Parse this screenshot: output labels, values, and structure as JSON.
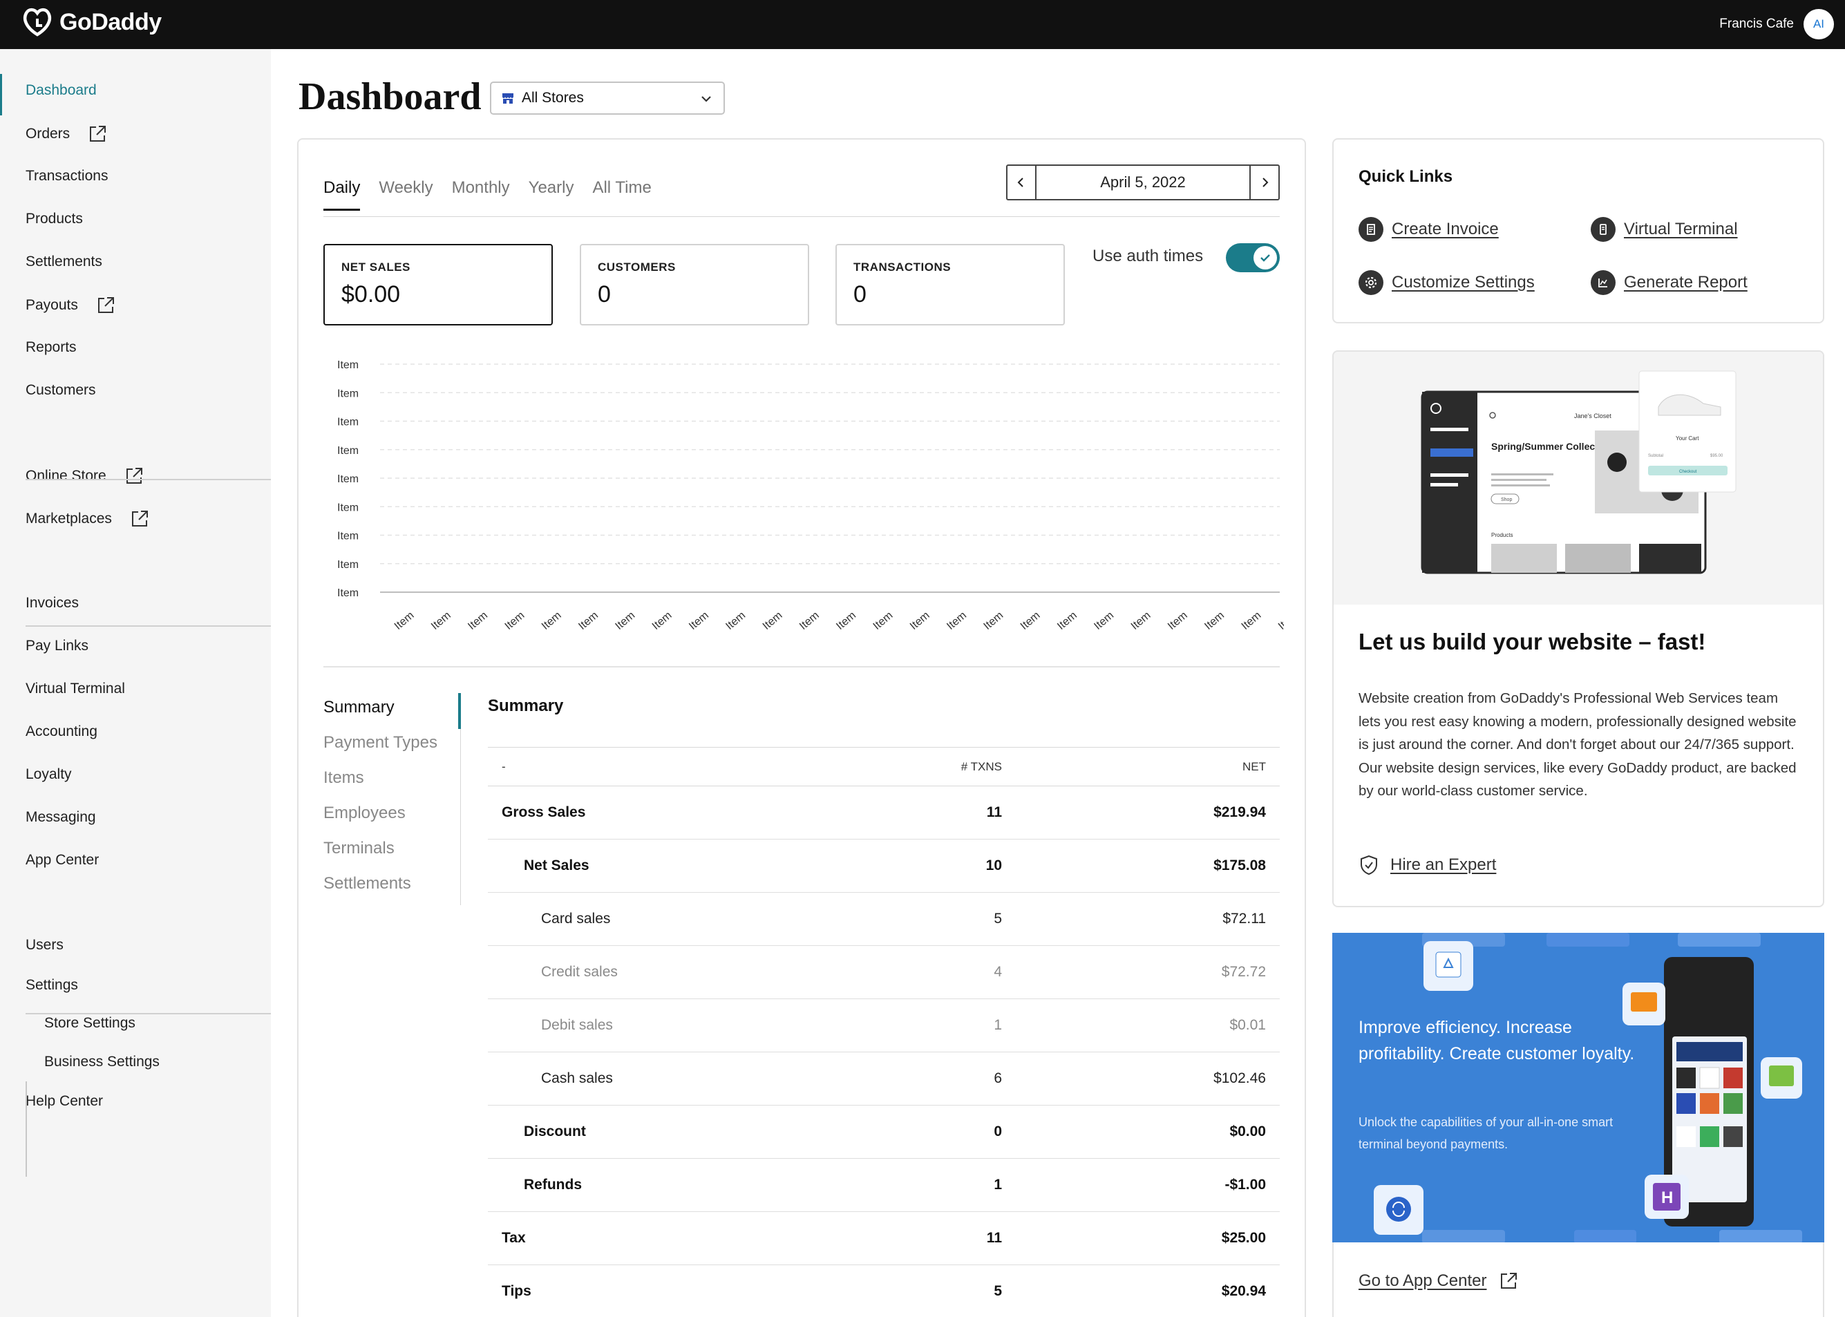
{
  "header": {
    "brand": "GoDaddy",
    "user_name": "Francis Cafe",
    "avatar_initials": "AI"
  },
  "sidebar": {
    "items": [
      {
        "label": "Dashboard",
        "external": false,
        "active": true
      },
      {
        "label": "Orders",
        "external": true
      },
      {
        "label": "Transactions",
        "external": false
      },
      {
        "label": "Products",
        "external": false
      },
      {
        "label": "Settlements",
        "external": false
      },
      {
        "label": "Payouts",
        "external": true
      },
      {
        "label": "Reports",
        "external": false
      },
      {
        "label": "Customers",
        "external": false
      },
      {
        "label": "Online Store",
        "external": true
      },
      {
        "label": "Marketplaces",
        "external": true
      },
      {
        "label": "Invoices",
        "external": false
      },
      {
        "label": "Pay Links",
        "external": false
      },
      {
        "label": "Virtual Terminal",
        "external": false
      },
      {
        "label": "Accounting",
        "external": false
      },
      {
        "label": "Loyalty",
        "external": false
      },
      {
        "label": "Messaging",
        "external": false
      },
      {
        "label": "App Center",
        "external": false
      },
      {
        "label": "Users",
        "external": false
      },
      {
        "label": "Settings",
        "external": false
      },
      {
        "label": "Store Settings",
        "external": false
      },
      {
        "label": "Business Settings",
        "external": false
      },
      {
        "label": "Help Center",
        "external": false
      }
    ]
  },
  "page": {
    "title": "Dashboard",
    "store_select": "All Stores"
  },
  "tabs": [
    "Daily",
    "Weekly",
    "Monthly",
    "Yearly",
    "All Time"
  ],
  "date": "April 5, 2022",
  "metrics": [
    {
      "label": "NET SALES",
      "value": "$0.00"
    },
    {
      "label": "CUSTOMERS",
      "value": "0"
    },
    {
      "label": "TRANSACTIONS",
      "value": "0"
    }
  ],
  "auth_toggle": {
    "label": "Use auth times",
    "on": true
  },
  "chart_data": {
    "type": "line",
    "y_tick_labels": [
      "Item",
      "Item",
      "Item",
      "Item",
      "Item",
      "Item",
      "Item",
      "Item",
      "Item"
    ],
    "x_tick_labels": [
      "Item",
      "Item",
      "Item",
      "Item",
      "Item",
      "Item",
      "Item",
      "Item",
      "Item",
      "Item",
      "Item",
      "Item",
      "Item",
      "Item",
      "Item",
      "Item",
      "Item",
      "Item",
      "Item",
      "Item",
      "Item",
      "Item",
      "Item",
      "Item",
      "Item"
    ],
    "series": [],
    "grid": true
  },
  "subnav": [
    "Summary",
    "Payment Types",
    "Items",
    "Employees",
    "Terminals",
    "Settlements"
  ],
  "summary": {
    "title": "Summary",
    "columns": [
      "-",
      "# TXNS",
      "NET"
    ],
    "rows": [
      {
        "label": "Gross Sales",
        "txns": "11",
        "net": "$219.94"
      },
      {
        "label": "Net Sales",
        "txns": "10",
        "net": "$175.08"
      },
      {
        "label": "Card sales",
        "txns": "5",
        "net": "$72.11"
      },
      {
        "label": "Credit sales",
        "txns": "4",
        "net": "$72.72"
      },
      {
        "label": "Debit sales",
        "txns": "1",
        "net": "$0.01"
      },
      {
        "label": "Cash sales",
        "txns": "6",
        "net": "$102.46"
      },
      {
        "label": "Discount",
        "txns": "0",
        "net": "$0.00"
      },
      {
        "label": "Refunds",
        "txns": "1",
        "net": "-$1.00"
      },
      {
        "label": "Tax",
        "txns": "11",
        "net": "$25.00"
      },
      {
        "label": "Tips",
        "txns": "5",
        "net": "$20.94"
      }
    ]
  },
  "quick_links": {
    "title": "Quick Links",
    "links": [
      {
        "label": "Create Invoice",
        "icon": "invoice-icon"
      },
      {
        "label": "Virtual Terminal",
        "icon": "terminal-icon"
      },
      {
        "label": "Customize Settings",
        "icon": "gear-icon"
      },
      {
        "label": "Generate Report",
        "icon": "report-icon"
      }
    ]
  },
  "website_promo": {
    "mock_store_name": "Jane's Closet",
    "mock_heading": "Spring/Summer Collection",
    "mock_cart": "Your Cart",
    "mock_products": "Products",
    "mock_subtotal": "Subtotal",
    "mock_price": "$95.00",
    "mock_checkout": "Checkout",
    "mock_shop": "Shop",
    "title": "Let us build your website – fast!",
    "description": "Website creation from GoDaddy's Professional Web Services team lets you rest easy knowing a modern, professionally designed website is just around the corner. And don't forget about our 24/7/365 support. Our website design services, like every GoDaddy product, are backed by our world-class customer service.",
    "cta": "Hire an Expert"
  },
  "terminal_promo": {
    "title": "Improve efficiency. Increase profitability. Create customer loyalty.",
    "subtitle": "Unlock the capabilities of your all-in-one smart terminal beyond payments.",
    "badge": "H",
    "cta": "Go to App Center"
  },
  "colors": {
    "accent": "#1b7c8a",
    "topbar": "#111111",
    "promo_blue": "#3b82d6"
  }
}
